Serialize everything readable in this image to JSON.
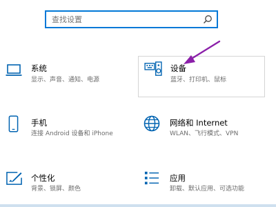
{
  "search": {
    "placeholder": "查找设置",
    "value": ""
  },
  "categories": [
    {
      "title": "系统",
      "desc": "显示、声音、通知、电源",
      "icon": "laptop-icon"
    },
    {
      "title": "设备",
      "desc": "蓝牙、打印机、鼠标",
      "icon": "keyboard-speaker-icon"
    },
    {
      "title": "手机",
      "desc": "连接 Android 设备和 iPhone",
      "icon": "phone-icon"
    },
    {
      "title": "网络和 Internet",
      "desc": "WLAN、飞行模式、VPN",
      "icon": "globe-icon"
    },
    {
      "title": "个性化",
      "desc": "背景、锁屏、颜色",
      "icon": "paint-icon"
    },
    {
      "title": "应用",
      "desc": "卸载、默认应用、可选功能",
      "icon": "apps-list-icon"
    }
  ],
  "colors": {
    "accent": "#0078d7",
    "annotation_arrow": "#8b1fa9"
  }
}
